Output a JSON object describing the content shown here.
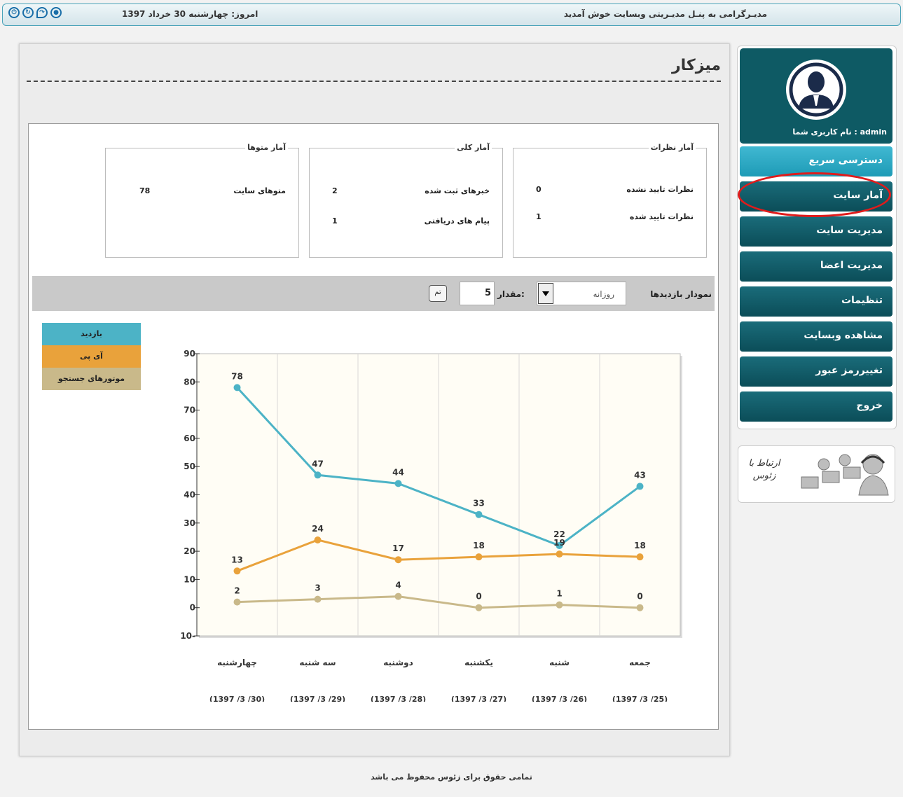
{
  "topbar": {
    "date": "امروز: چهارشنبه 30 خرداد 1397",
    "welcome": "مدیـرگرامی به پنـل مدیـریتی وبسایت خوش آمدید",
    "icons": [
      "power-icon",
      "refresh-icon",
      "redo-icon",
      "eye-icon"
    ]
  },
  "page": {
    "title": "میزکار"
  },
  "stats": {
    "comments": {
      "title": "آمار نظرات",
      "rows": [
        {
          "label": "نظرات تایید نشده",
          "value": "0"
        },
        {
          "label": "نظرات تایید شده",
          "value": "1"
        }
      ]
    },
    "general": {
      "title": "آمار کلی",
      "rows": [
        {
          "label": "خبرهای ثبت شده",
          "value": "2"
        },
        {
          "label": "پیام های دریافتی",
          "value": "1"
        }
      ]
    },
    "texts": {
      "title": "آمار متوها",
      "rows": [
        {
          "label": "متوهای سایت",
          "value": "78"
        }
      ]
    }
  },
  "filter": {
    "title": "نمودار بازدیدها",
    "period": "روزانه",
    "amount_label": "مقدار:",
    "amount": "5",
    "ok": "تم"
  },
  "legend": [
    {
      "label": "بازدید",
      "color": "#4cb3c6"
    },
    {
      "label": "آی پی",
      "color": "#e9a23b"
    },
    {
      "label": "موتورهای جستجو",
      "color": "#c9b98a"
    }
  ],
  "chart_data": {
    "type": "line",
    "ylim": [
      -10,
      90
    ],
    "yticks": [
      90,
      80,
      70,
      60,
      50,
      40,
      30,
      20,
      10,
      0,
      -10
    ],
    "ytick_labels": [
      "90",
      "80",
      "70",
      "60",
      "50",
      "40",
      "30",
      "20",
      "10",
      "0",
      "10-"
    ],
    "categories": [
      "جمعه",
      "شنبه",
      "یکشنبه",
      "دوشنبه",
      "سه شنبه",
      "چهارشنبه"
    ],
    "dates": [
      "(1397 /3 /25)",
      "(1397 /3 /26)",
      "(1397 /3 /27)",
      "(1397 /3 /28)",
      "(1397 /3 /29)",
      "(1397 /3 /30)"
    ],
    "series": [
      {
        "name": "بازدید",
        "color": "#4cb3c6",
        "values": [
          43,
          22,
          33,
          44,
          47,
          78
        ]
      },
      {
        "name": "آی پی",
        "color": "#e9a23b",
        "values": [
          18,
          19,
          18,
          17,
          24,
          13
        ]
      },
      {
        "name": "موتورهای جستجو",
        "color": "#c9b98a",
        "values": [
          0,
          1,
          0,
          4,
          3,
          2
        ]
      }
    ],
    "background": "#fffdf5",
    "grid": true
  },
  "sidebar": {
    "username": "نام کاربری شما : admin",
    "items": [
      {
        "label": "دسترسی سریع",
        "name": "quick-access"
      },
      {
        "label": "آمار سایت",
        "name": "site-stats"
      },
      {
        "label": "مدیریت سایت",
        "name": "site-management"
      },
      {
        "label": "مدیریت اعضا",
        "name": "members-management"
      },
      {
        "label": "تنظیمات",
        "name": "settings"
      },
      {
        "label": "مشاهده وبسایت",
        "name": "view-website"
      },
      {
        "label": "تغییررمز عبور",
        "name": "change-password"
      },
      {
        "label": "خروج",
        "name": "logout"
      }
    ],
    "support": "ارتباط با زئوس"
  },
  "footer": {
    "text": "تمامی حقوق برای زئوس محفوظ می باشد"
  }
}
